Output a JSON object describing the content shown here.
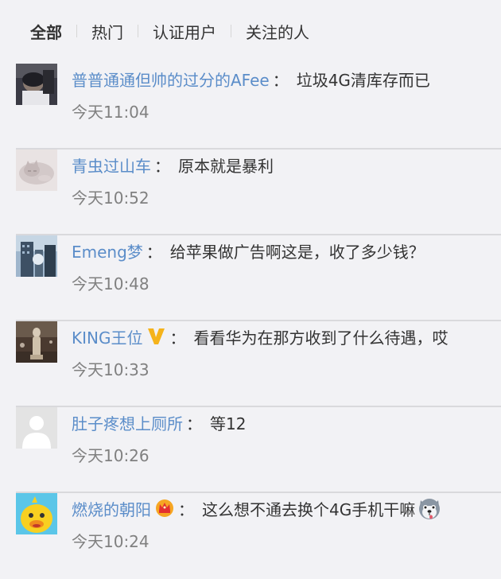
{
  "tabs": [
    {
      "label": "全部"
    },
    {
      "label": "热门"
    },
    {
      "label": "认证用户"
    },
    {
      "label": "关注的人"
    }
  ],
  "colon": "：",
  "comments": [
    {
      "username": "普普通通但帅的过分的AFee",
      "content": "垃圾4G清库存而已",
      "time": "今天11:04"
    },
    {
      "username": "青虫过山车",
      "content": "原本就是暴利",
      "time": "今天10:52"
    },
    {
      "username": "Emeng梦",
      "content": "给苹果做广告啊这是，收了多少钱？",
      "time": "今天10:48"
    },
    {
      "username": "KING王位",
      "content": "看看华为在那方收到了什么待遇，哎",
      "time": "今天10:33",
      "badge": "vip-v-badge-icon"
    },
    {
      "username": "肚子疼想上厕所",
      "content": "等12",
      "time": "今天10:26"
    },
    {
      "username": "燃烧的朝阳",
      "content": "这么想不通去换个4G手机干嘛",
      "time": "今天10:24",
      "badge": "crown-badge-icon",
      "emoji": "husky-dog-emoji-icon"
    }
  ]
}
